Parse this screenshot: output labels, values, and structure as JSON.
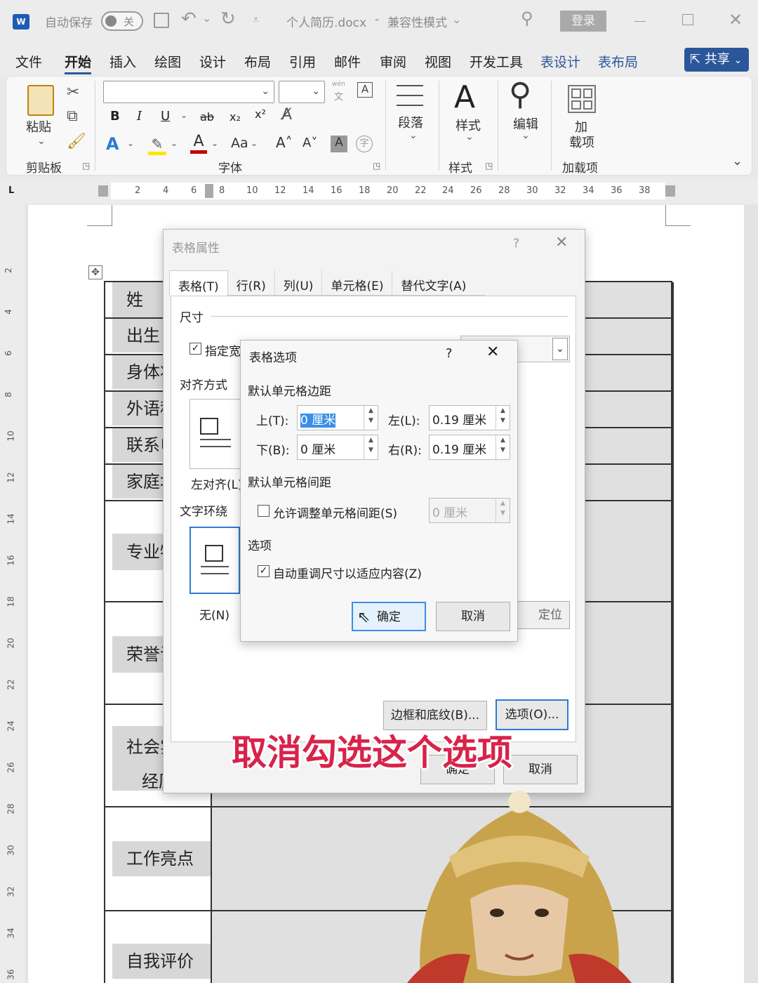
{
  "titlebar": {
    "autosave": "自动保存",
    "toggle": "关",
    "filename": "个人简历.docx",
    "sep": "-",
    "mode": "兼容性模式",
    "login": "登录",
    "undo_arrow": "⌄"
  },
  "menu_tabs": [
    "文件",
    "开始",
    "插入",
    "绘图",
    "设计",
    "布局",
    "引用",
    "邮件",
    "审阅",
    "视图",
    "开发工具",
    "表设计",
    "表布局"
  ],
  "share": "共享",
  "ribbon": {
    "paste": "粘贴",
    "clipboard": "剪贴板",
    "font_group": "字体",
    "paragraph": "段落",
    "styles_btn": "样式",
    "styles_group": "样式",
    "edit": "编辑",
    "addin_btn1": "加",
    "addin_btn2": "载项",
    "addins_group": "加载项",
    "bold": "B",
    "italic": "I",
    "underline": "U",
    "strike": "ab",
    "sub": "x₂",
    "sup": "x²",
    "aa": "Aa",
    "grow": "A˄",
    "shrink": "A˅",
    "wen": "wén",
    "pinyin": "文"
  },
  "ruler": [
    "2",
    "4",
    "6",
    "8",
    "10",
    "12",
    "14",
    "16",
    "18",
    "20",
    "22",
    "24",
    "26",
    "28",
    "30",
    "32",
    "34",
    "36",
    "38"
  ],
  "vruler": [
    "2",
    "4",
    "6",
    "8",
    "10",
    "12",
    "14",
    "16",
    "18",
    "20",
    "22",
    "24",
    "26",
    "28",
    "30",
    "32",
    "34",
    "36"
  ],
  "doc_rows": [
    "姓",
    "出生日",
    "身体状",
    "外语程",
    "联系电",
    "家庭地",
    "专业特",
    "荣誉证",
    "社会实",
    "经历",
    "工作亮点",
    "自我评价"
  ],
  "table_props": {
    "title": "表格属性",
    "help": "?",
    "tabs": [
      "表格(T)",
      "行(R)",
      "列(U)",
      "单元格(E)",
      "替代文字(A)"
    ],
    "size": "尺寸",
    "specify_width": "指定宽",
    "align": "对齐方式",
    "left_align": "左对齐(L)",
    "wrap": "文字环绕",
    "none": "无(N)",
    "position": "定位(P)...",
    "borders": "边框和底纹(B)...",
    "options": "选项(O)...",
    "ok": "确定",
    "cancel": "取消"
  },
  "table_options": {
    "title": "表格选项",
    "help": "?",
    "margins_section": "默认单元格边距",
    "top_label": "上(T):",
    "top_value": "0 厘米",
    "left_label": "左(L):",
    "left_value": "0.19 厘米",
    "bottom_label": "下(B):",
    "bottom_value": "0 厘米",
    "right_label": "右(R):",
    "right_value": "0.19 厘米",
    "spacing_section": "默认单元格间距",
    "allow_spacing": "允许调整单元格间距(S)",
    "spacing_value": "0 厘米",
    "options_section": "选项",
    "autofit": "自动重调尺寸以适应内容(Z)",
    "ok": "确定",
    "cancel": "取消"
  },
  "caption": "取消勾选这个选项",
  "colors": {
    "accent": "#2b579a",
    "caption": "#d8234a"
  }
}
